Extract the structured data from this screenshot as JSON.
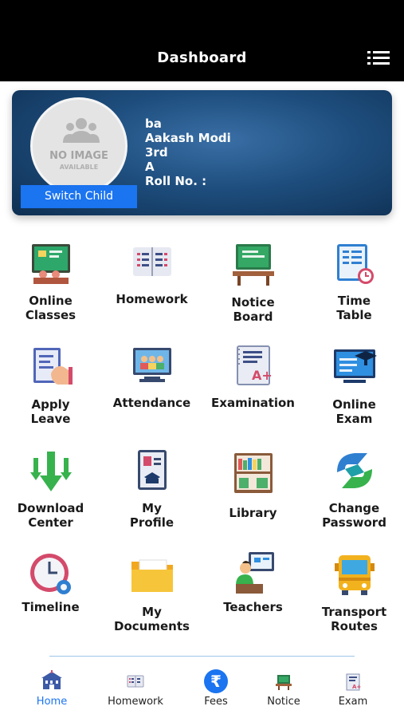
{
  "header": {
    "title": "Dashboard",
    "menu_icon": "list-menu-icon"
  },
  "profile": {
    "avatar_text": "NO IMAGE",
    "avatar_subtext": "AVAILABLE",
    "switch_label": "Switch Child",
    "lines": [
      "ba",
      "Aakash Modi",
      "3rd",
      "A",
      "Roll No. :"
    ]
  },
  "tiles": [
    {
      "label": "Online\nClasses",
      "icon": "online-classes-icon"
    },
    {
      "label": "Homework",
      "icon": "homework-icon"
    },
    {
      "label": "Notice\nBoard",
      "icon": "notice-board-icon"
    },
    {
      "label": "Time\nTable",
      "icon": "time-table-icon"
    },
    {
      "label": "Apply\nLeave",
      "icon": "apply-leave-icon"
    },
    {
      "label": "Attendance",
      "icon": "attendance-icon"
    },
    {
      "label": "Examination",
      "icon": "examination-icon"
    },
    {
      "label": "Online\nExam",
      "icon": "online-exam-icon"
    },
    {
      "label": "Download\nCenter",
      "icon": "download-center-icon"
    },
    {
      "label": "My\nProfile",
      "icon": "my-profile-icon"
    },
    {
      "label": "Library",
      "icon": "library-icon"
    },
    {
      "label": "Change\nPassword",
      "icon": "change-password-icon"
    },
    {
      "label": "Timeline",
      "icon": "timeline-icon"
    },
    {
      "label": "My\nDocuments",
      "icon": "my-documents-icon"
    },
    {
      "label": "Teachers",
      "icon": "teachers-icon"
    },
    {
      "label": "Transport\nRoutes",
      "icon": "transport-routes-icon"
    }
  ],
  "bottom_nav": [
    {
      "label": "Home",
      "icon": "school-home-icon",
      "active": true
    },
    {
      "label": "Homework",
      "icon": "homework-icon"
    },
    {
      "label": "Fees",
      "icon": "rupee-icon"
    },
    {
      "label": "Notice",
      "icon": "notice-board-icon"
    },
    {
      "label": "Exam",
      "icon": "exam-icon"
    }
  ],
  "colors": {
    "accent": "#1b74f0",
    "header_bg": "#000000",
    "card_bg": "#1e4e7e"
  }
}
